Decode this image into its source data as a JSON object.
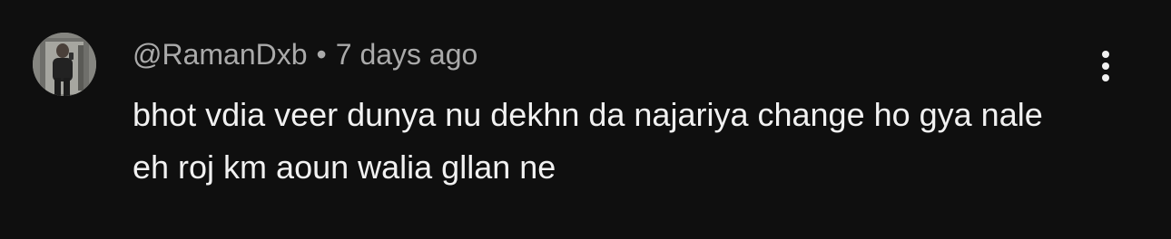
{
  "comment": {
    "author": "@RamanDxb",
    "separator": "•",
    "timestamp": "7 days ago",
    "text": "bhot vdia veer dunya nu dekhn da najariya change ho gya nale eh roj km aoun walia gllan ne",
    "avatar_icon": "user-avatar-photo",
    "more_icon": "more-vert-icon"
  },
  "colors": {
    "background": "#0f0f0f",
    "primary_text": "#f1f1f1",
    "secondary_text": "#aaaaaa"
  }
}
